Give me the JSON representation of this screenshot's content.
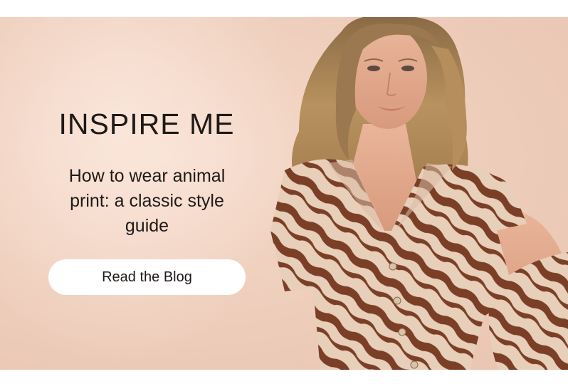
{
  "hero": {
    "headline": "INSPIRE ME",
    "subtitle": "How to wear animal print: a classic style guide",
    "cta_label": "Read the Blog"
  },
  "colors": {
    "background": "#efcfbd",
    "text": "#1f1a18",
    "button": "#ffffff",
    "print_brown": "#7a3f26",
    "print_cream": "#ead2bd"
  }
}
